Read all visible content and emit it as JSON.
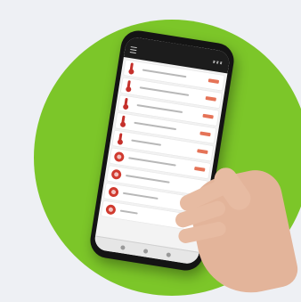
{
  "colors": {
    "background": "#eef0f4",
    "accent_green": "#7cc629",
    "phone_body": "#141414",
    "icon_red": "#c4302b"
  },
  "app": {
    "rows": [
      {
        "icon": "thermometer-icon"
      },
      {
        "icon": "thermometer-icon"
      },
      {
        "icon": "thermometer-icon"
      },
      {
        "icon": "thermometer-icon"
      },
      {
        "icon": "thermometer-icon"
      },
      {
        "icon": "alert-circle-icon"
      },
      {
        "icon": "alert-circle-icon"
      },
      {
        "icon": "alert-circle-icon"
      },
      {
        "icon": "alert-circle-icon"
      }
    ]
  }
}
